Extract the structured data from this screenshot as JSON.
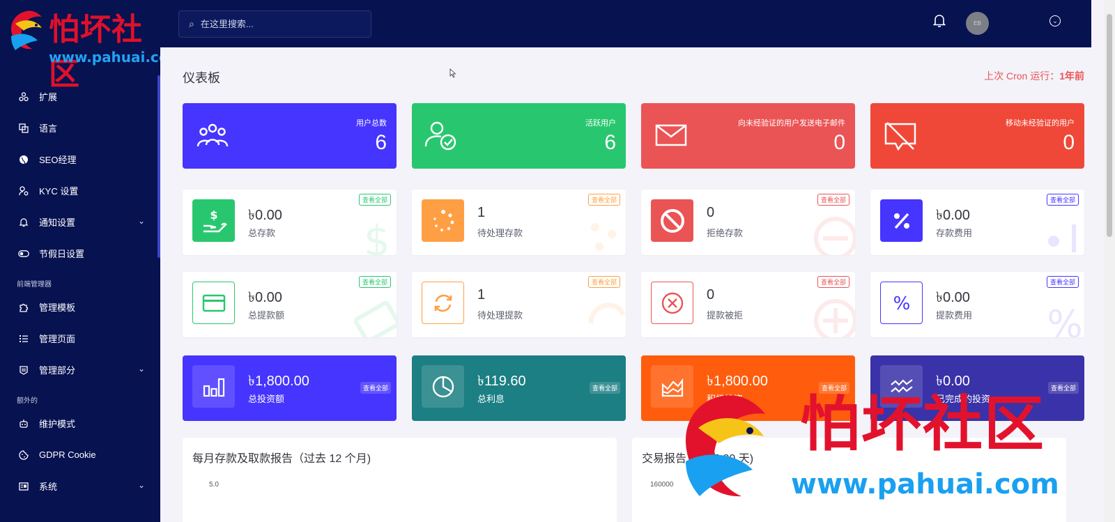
{
  "logo": {
    "title": "怕坏社区",
    "url": "www.pahuai.com"
  },
  "sidebar": {
    "items": [
      {
        "label": "扩展",
        "icon": "extensions-icon",
        "chevron": false
      },
      {
        "label": "语言",
        "icon": "language-icon",
        "chevron": false
      },
      {
        "label": "SEO经理",
        "icon": "globe-icon",
        "chevron": false
      },
      {
        "label": "KYC 设置",
        "icon": "user-cog-icon",
        "chevron": false
      },
      {
        "label": "通知设置",
        "icon": "bell-icon",
        "chevron": true
      },
      {
        "label": "节假日设置",
        "icon": "toggle-icon",
        "chevron": false
      }
    ],
    "section_frontend": "前端管理器",
    "frontend_items": [
      {
        "label": "管理模板",
        "icon": "puzzle-icon",
        "chevron": false
      },
      {
        "label": "管理页面",
        "icon": "list-icon",
        "chevron": false
      },
      {
        "label": "管理部分",
        "icon": "section-icon",
        "chevron": true
      }
    ],
    "section_extra": "额外的",
    "extra_items": [
      {
        "label": "维护模式",
        "icon": "robot-icon",
        "chevron": false
      },
      {
        "label": "GDPR Cookie",
        "icon": "cookie-icon",
        "chevron": false
      },
      {
        "label": "系统",
        "icon": "server-icon",
        "chevron": true
      }
    ]
  },
  "topbar": {
    "search_placeholder": "在这里搜索...",
    "avatar_text": "EB"
  },
  "page": {
    "title": "仪表板",
    "cron_label": "上次 Cron 运行：",
    "cron_value": "1年前"
  },
  "stats_top": [
    {
      "label": "用户总数",
      "value": "6",
      "color": "#4634ff"
    },
    {
      "label": "活跃用户",
      "value": "6",
      "color": "#28c76f"
    },
    {
      "label": "向未经验证的用户发送电子邮件",
      "value": "0",
      "color": "#eb5455"
    },
    {
      "label": "移动未经验证的用户",
      "value": "0",
      "color": "#f04838"
    }
  ],
  "view_all": "查看全部",
  "deposit_cards": [
    {
      "value": "৳0.00",
      "label": "总存款",
      "color": "#28c76f"
    },
    {
      "value": "1",
      "label": "待处理存款",
      "color": "#ff9f43"
    },
    {
      "value": "0",
      "label": "拒绝存款",
      "color": "#ea5455"
    },
    {
      "value": "৳0.00",
      "label": "存款费用",
      "color": "#4634ff"
    }
  ],
  "withdraw_cards": [
    {
      "value": "৳0.00",
      "label": "总提款额",
      "color": "#28c76f"
    },
    {
      "value": "1",
      "label": "待处理提款",
      "color": "#ff9f43"
    },
    {
      "value": "0",
      "label": "提款被拒",
      "color": "#ea5455"
    },
    {
      "value": "৳0.00",
      "label": "提款费用",
      "color": "#4634ff"
    }
  ],
  "invest_cards": [
    {
      "value": "৳1,800.00",
      "label": "总投资额",
      "color": "#4634ff"
    },
    {
      "value": "৳119.60",
      "label": "总利息",
      "color": "#1b7f83"
    },
    {
      "value": "৳1,800.00",
      "label": "积极投资",
      "color": "#ff5c0d"
    },
    {
      "value": "৳0.00",
      "label": "已完成的投资",
      "color": "#3a32a8"
    }
  ],
  "reports": {
    "monthly_title": "每月存款及取款报告（过去 12 个月)",
    "monthly_y_top": "5.0",
    "transaction_title": "交易报告（过去 30 天)",
    "transaction_y_top": "160000"
  },
  "watermark": {
    "title": "怕坏社区",
    "url": "www.pahuai.com"
  }
}
